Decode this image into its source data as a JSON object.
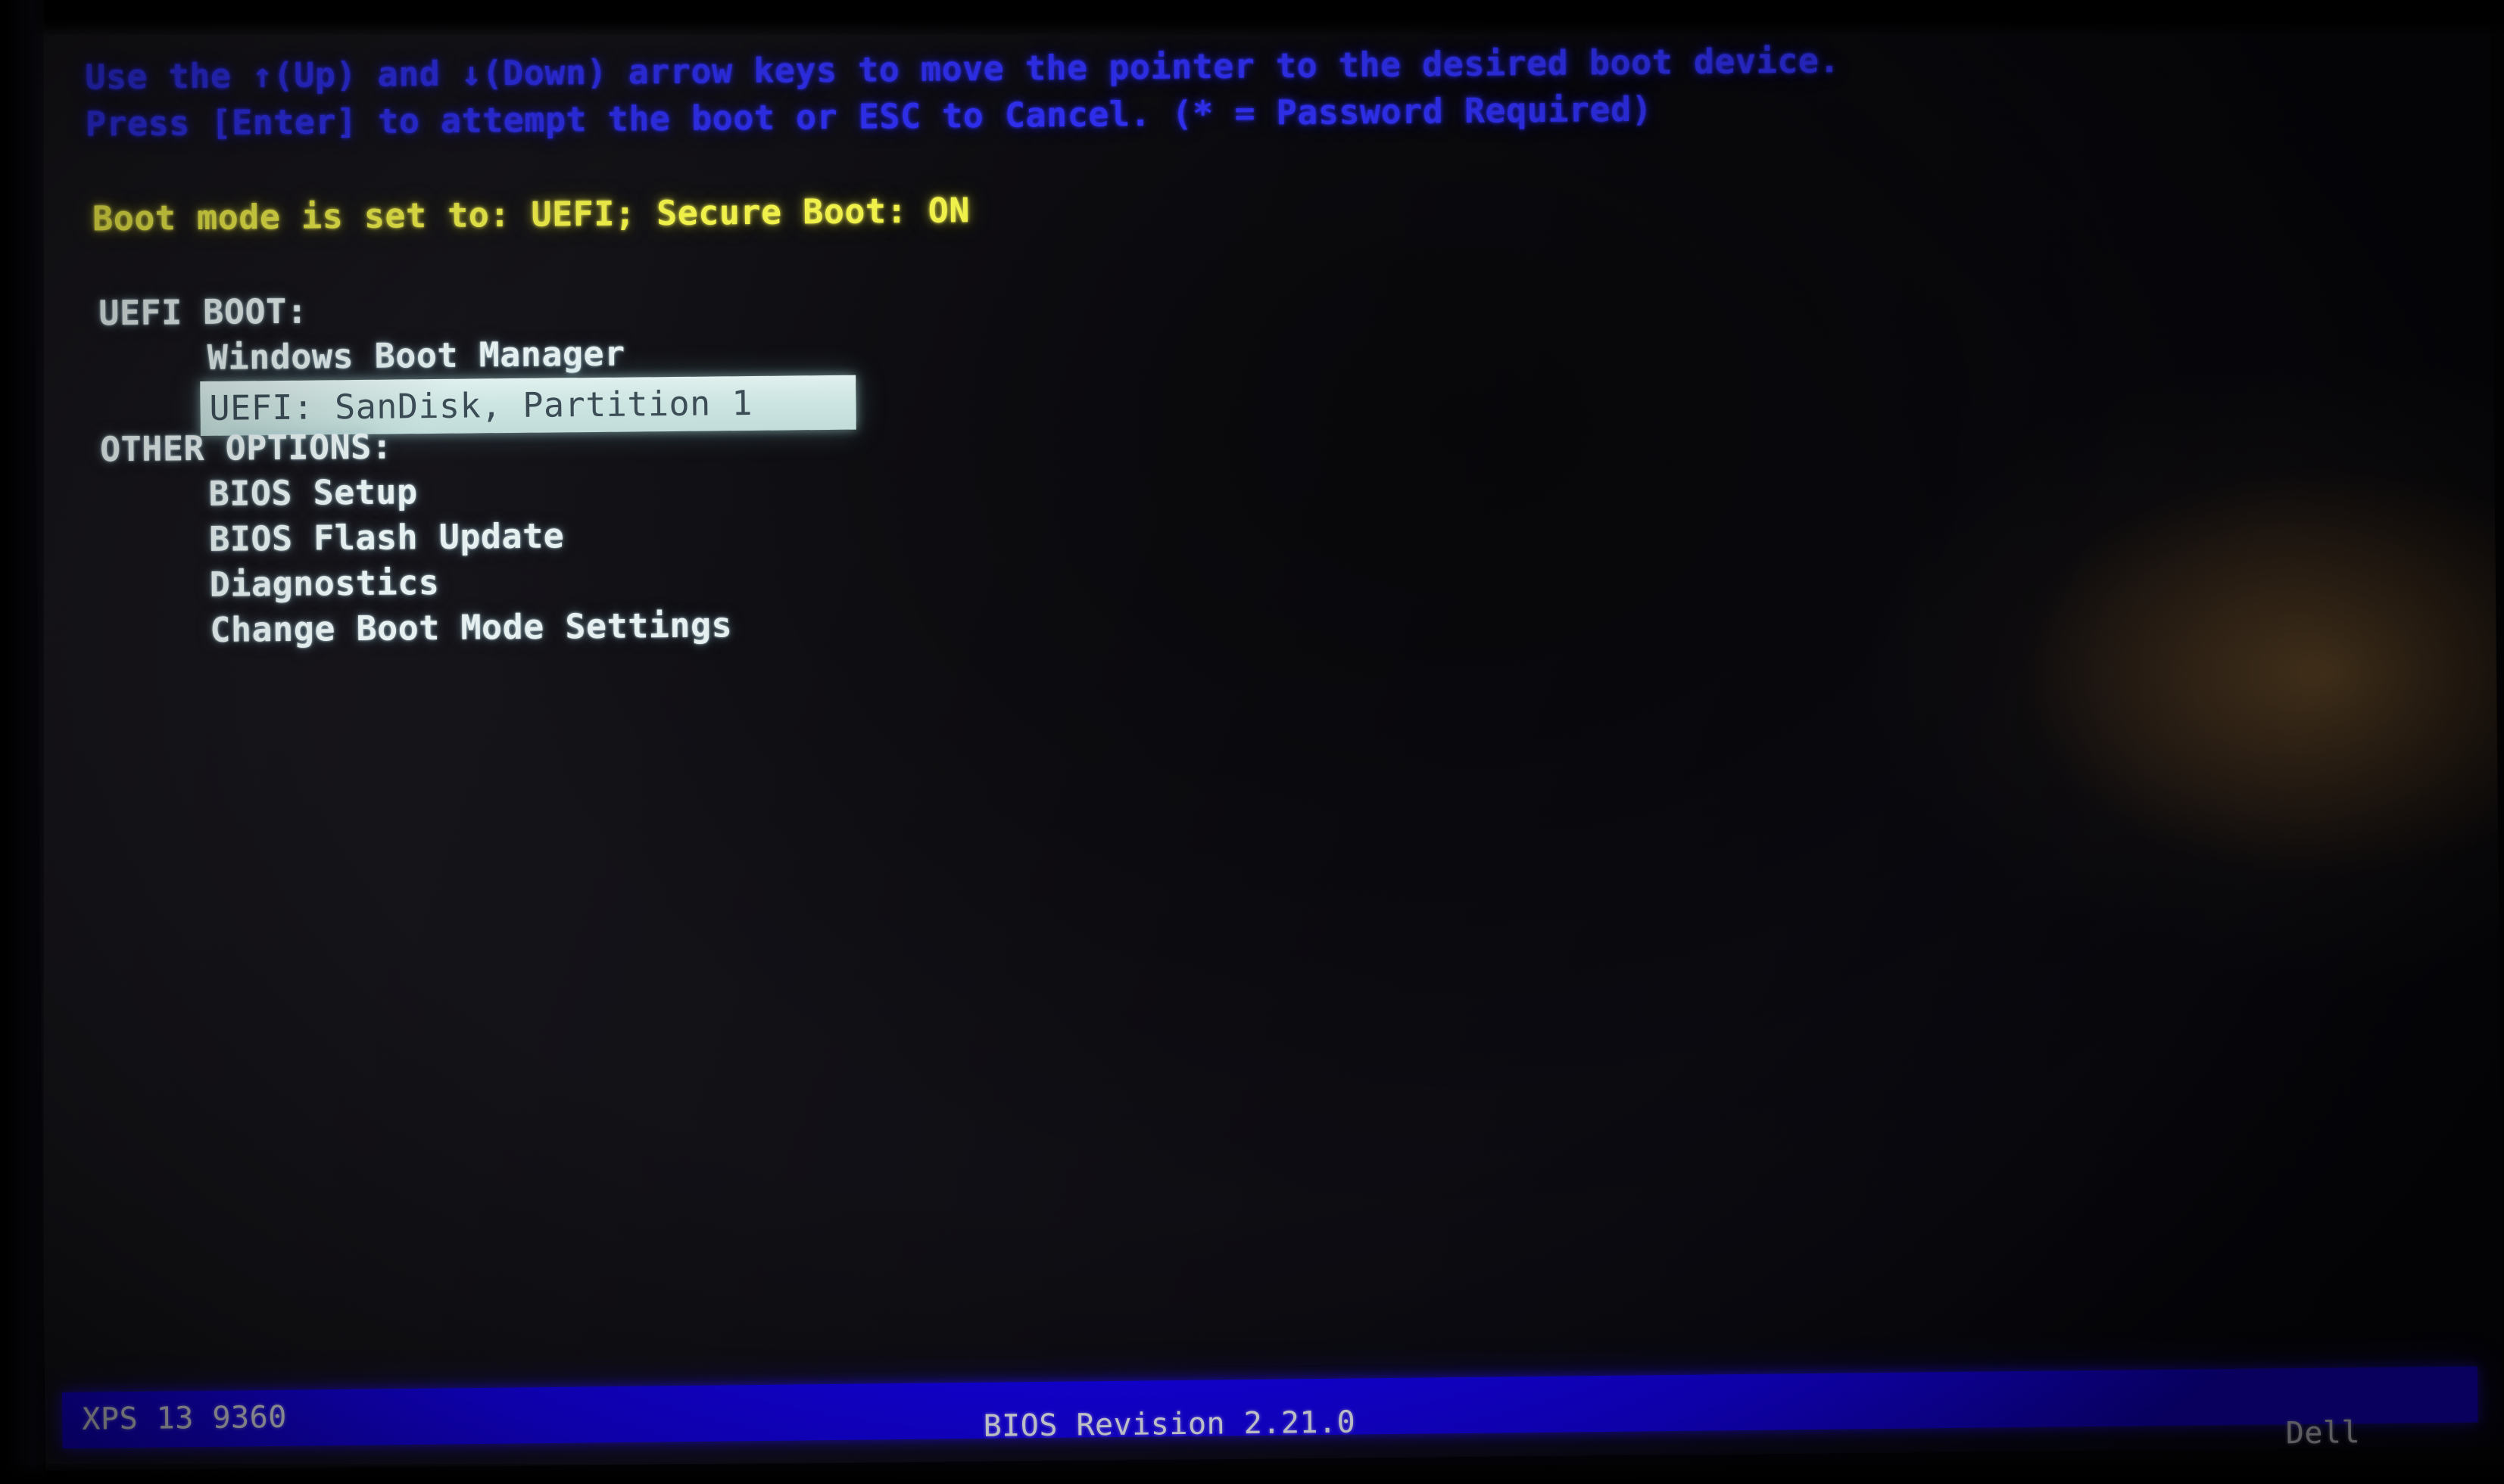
{
  "screen": {
    "background_color": "#0a0a11",
    "bezel_color": "#050406"
  },
  "instructions": {
    "line1": "Use the ↑(Up) and ↓(Down) arrow keys to move the pointer to the desired boot device.",
    "line2": "Press [Enter] to attempt the boot or ESC to Cancel. (* = Password Required)",
    "color": "#2f2ff0"
  },
  "boot_mode_status": {
    "text": "Boot mode is set to: UEFI; Secure Boot: ON",
    "mode": "UEFI",
    "secure_boot": "ON",
    "color": "#f2f24a"
  },
  "uefi_boot": {
    "heading": "UEFI BOOT:",
    "items": [
      {
        "label": "Windows Boot Manager",
        "selected": false
      },
      {
        "label": "UEFI: SanDisk, Partition 1",
        "selected": true
      }
    ]
  },
  "other_options": {
    "heading": "OTHER OPTIONS:",
    "items": [
      {
        "label": "BIOS Setup"
      },
      {
        "label": "BIOS Flash Update"
      },
      {
        "label": "Diagnostics"
      },
      {
        "label": "Change Boot Mode Settings"
      }
    ]
  },
  "selection": {
    "highlight_background": "#cfe7e4",
    "highlight_text_color": "#3c4d57",
    "selected_label": "UEFI: SanDisk, Partition 1"
  },
  "status_bar": {
    "model": "XPS 13 9360",
    "bios_revision": "BIOS Revision 2.21.0",
    "vendor": "Dell",
    "background_color": "#1400f2",
    "text_color": "#f2f4ff"
  }
}
